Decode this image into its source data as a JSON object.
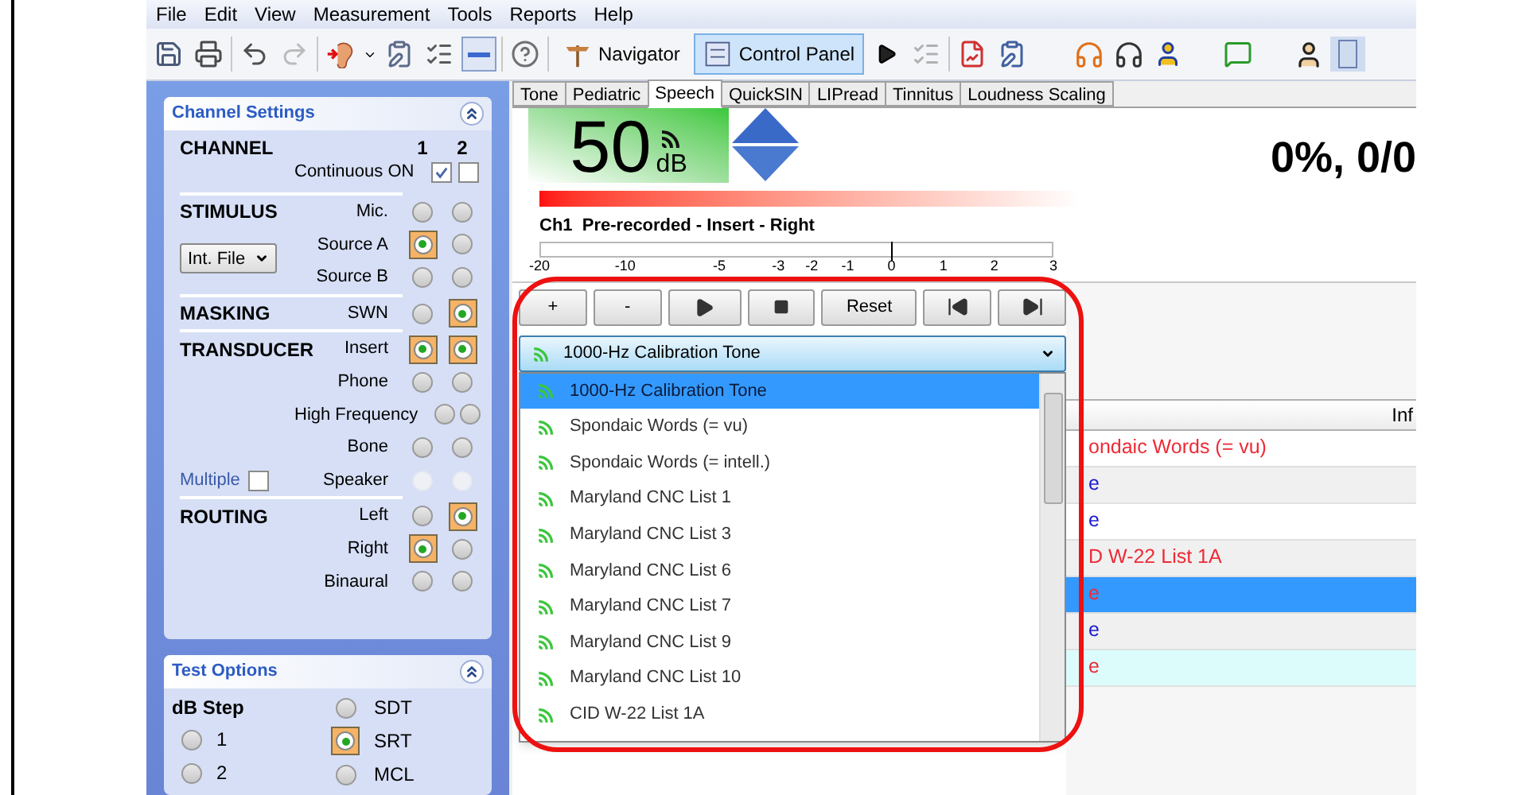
{
  "menu": [
    "File",
    "Edit",
    "View",
    "Measurement",
    "Tools",
    "Reports",
    "Help"
  ],
  "toolbar": {
    "buttons": [
      {
        "label": "Navigator",
        "selected": false
      },
      {
        "label": "Control Panel",
        "selected": true
      }
    ]
  },
  "channel_settings": {
    "title": "Channel Settings",
    "expanded": true,
    "columns": [
      "1",
      "2"
    ],
    "sections": [
      {
        "heading": "CHANNEL",
        "rows": [
          {
            "label": "Continuous ON",
            "kind": "checkbox",
            "ch1": true,
            "ch2": false,
            "disabled": false
          }
        ]
      },
      {
        "heading": "STIMULUS",
        "rows": [
          {
            "label": "Mic.",
            "kind": "radio",
            "ch1": false,
            "ch2": false,
            "disabled": false
          },
          {
            "label": "Source A",
            "kind": "radio",
            "ch1": true,
            "ch2": false,
            "disabled": false,
            "extra": {
              "kind": "select",
              "value": "Int. File"
            }
          },
          {
            "label": "Source B",
            "kind": "radio",
            "ch1": false,
            "ch2": false,
            "disabled": false
          }
        ]
      },
      {
        "heading": "MASKING",
        "rows": [
          {
            "label": "SWN",
            "kind": "radio",
            "ch1": false,
            "ch2": true,
            "disabled": false
          }
        ]
      },
      {
        "heading": "TRANSDUCER",
        "rows": [
          {
            "label": "Insert",
            "kind": "radio",
            "ch1": true,
            "ch2": true,
            "disabled": false
          },
          {
            "label": "Phone",
            "kind": "radio",
            "ch1": false,
            "ch2": false,
            "disabled": false
          },
          {
            "label": "High Frequency",
            "kind": "radio",
            "ch1": false,
            "ch2": false,
            "disabled": false
          },
          {
            "label": "Bone",
            "kind": "radio",
            "ch1": false,
            "ch2": false,
            "disabled": false
          },
          {
            "label": "Speaker",
            "kind": "radio",
            "ch1": false,
            "ch2": false,
            "disabled": true,
            "extra": {
              "kind": "checkbox",
              "label": "Multiple",
              "checked": false
            }
          }
        ]
      },
      {
        "heading": "ROUTING",
        "rows": [
          {
            "label": "Left",
            "kind": "radio",
            "ch1": false,
            "ch2": true,
            "disabled": false
          },
          {
            "label": "Right",
            "kind": "radio",
            "ch1": true,
            "ch2": false,
            "disabled": false
          },
          {
            "label": "Binaural",
            "kind": "radio",
            "ch1": false,
            "ch2": false,
            "disabled": false
          }
        ]
      }
    ]
  },
  "test_options": {
    "title": "Test Options",
    "expanded": true,
    "heading": "dB Step",
    "steps": [
      {
        "label": "1",
        "selected": false
      },
      {
        "label": "2",
        "selected": false
      }
    ],
    "tests": [
      {
        "label": "SDT",
        "selected": false
      },
      {
        "label": "SRT",
        "selected": true
      },
      {
        "label": "MCL",
        "selected": false
      }
    ]
  },
  "tabs": [
    {
      "label": "Tone",
      "selected": false
    },
    {
      "label": "Pediatric",
      "selected": false
    },
    {
      "label": "Speech",
      "selected": true
    },
    {
      "label": "QuickSIN",
      "selected": false
    },
    {
      "label": "LIPread",
      "selected": false
    },
    {
      "label": "Tinnitus",
      "selected": false
    },
    {
      "label": "Loudness Scaling",
      "selected": false
    }
  ],
  "level_display": {
    "value": "50",
    "unit": "dB"
  },
  "score": "0%, 0/0",
  "channel_info": "Ch1  Pre-recorded - Insert - Right",
  "scale": {
    "level": 0.685,
    "labels": [
      "-20",
      "-10",
      "-5",
      "-3",
      "-2",
      "-1",
      "0",
      "1",
      "2",
      "3"
    ]
  },
  "controls": [
    {
      "kind": "text",
      "label": "+"
    },
    {
      "kind": "text",
      "label": "-"
    },
    {
      "kind": "play"
    },
    {
      "kind": "stop"
    },
    {
      "kind": "text",
      "label": "Reset"
    },
    {
      "kind": "previous"
    },
    {
      "kind": "next"
    }
  ],
  "material_select": {
    "value": "1000-Hz Calibration Tone",
    "expanded": true,
    "options": [
      {
        "label": "1000-Hz Calibration Tone",
        "selected": true
      },
      {
        "label": "Spondaic Words (= vu)",
        "selected": false
      },
      {
        "label": "Spondaic Words (= intell.)",
        "selected": false
      },
      {
        "label": "Maryland CNC List 1",
        "selected": false
      },
      {
        "label": "Maryland CNC List 3",
        "selected": false
      },
      {
        "label": "Maryland CNC List 6",
        "selected": false
      },
      {
        "label": "Maryland CNC List 7",
        "selected": false
      },
      {
        "label": "Maryland CNC List 9",
        "selected": false
      },
      {
        "label": "Maryland CNC List 10",
        "selected": false
      },
      {
        "label": "CID W-22 List 1A",
        "selected": false
      }
    ]
  },
  "table": {
    "header": "Inf",
    "rows": [
      {
        "text": "ondaic Words (= vu)",
        "color": "#ee2a36",
        "selected": false,
        "highlighted": false
      },
      {
        "text": "e",
        "color": "#1a1ad0",
        "selected": false,
        "highlighted": false
      },
      {
        "text": "e",
        "color": "#1a1ad0",
        "selected": false,
        "highlighted": false
      },
      {
        "text": "D W-22 List 1A",
        "color": "#ee2a36",
        "selected": false,
        "highlighted": false
      },
      {
        "text": "e",
        "color": "#ee2a36",
        "selected": true,
        "highlighted": false
      },
      {
        "text": "e",
        "color": "#1a1ad0",
        "selected": false,
        "highlighted": false
      },
      {
        "text": "e",
        "color": "#ee2a36",
        "selected": false,
        "highlighted": true
      }
    ]
  }
}
